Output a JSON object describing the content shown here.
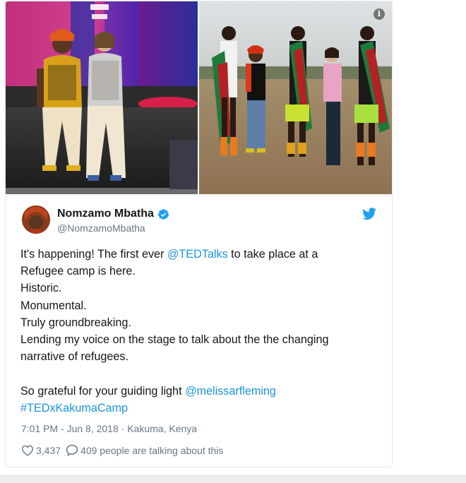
{
  "tweet": {
    "display_name": "Nomzamo Mbatha",
    "handle": "@NomzamoMbatha",
    "body": {
      "line1_prefix": "It's happening! The first ever ",
      "line1_mention": "@TEDTalks",
      "line1_suffix": " to take place at a",
      "line2": "Refugee camp is here.",
      "line3": "Historic.",
      "line4": "Monumental.",
      "line5": "Truly groundbreaking.",
      "line6": "Lending my voice on the stage to talk about the the changing",
      "line7": "narrative of refugees.",
      "line9_prefix": "So grateful for your guiding light ",
      "line9_mention": "@melissarfleming",
      "line10_hashtag": "#TEDxKakumaCamp"
    },
    "timestamp": "7:01 PM - Jun 8, 2018",
    "location_separator": " · ",
    "location": "Kakuma, Kenya",
    "likes": "3,437",
    "talking": "409 people are talking about this"
  },
  "icons": {
    "verified": "verified-badge-icon",
    "brand": "twitter-bird-icon",
    "info": "info-icon",
    "like": "heart-icon",
    "reply": "speech-bubble-icon"
  },
  "colors": {
    "link": "#1b95e0",
    "text": "#14171a",
    "muted": "#657786",
    "border": "#e1e8ed",
    "verified": "#1da1f2"
  }
}
